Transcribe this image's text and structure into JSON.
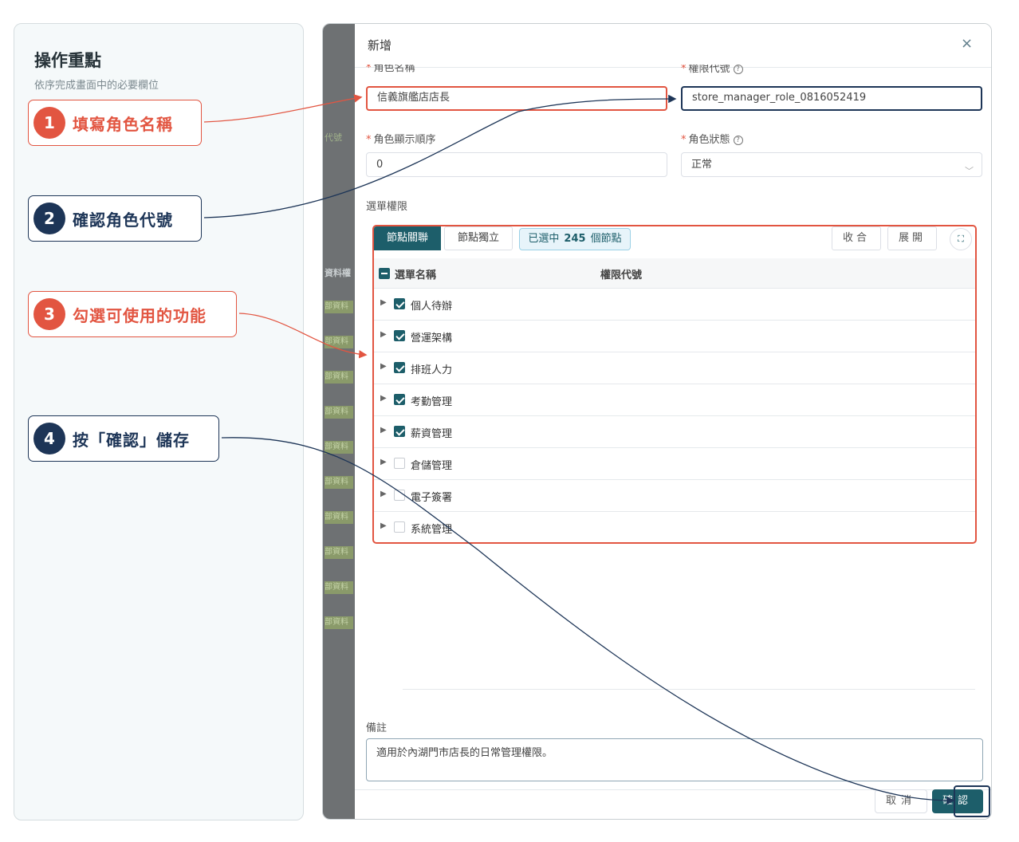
{
  "guide": {
    "title": "操作重點",
    "subtitle": "依序完成畫面中的必要欄位",
    "steps": [
      {
        "num": "1",
        "text": "填寫角色名稱"
      },
      {
        "num": "2",
        "text": "確認角色代號"
      },
      {
        "num": "3",
        "text": "勾選可使用的功能"
      },
      {
        "num": "4",
        "text": "按「確認」儲存"
      }
    ]
  },
  "background": {
    "code_label": "代號",
    "column_header": "資料權",
    "row_tag": "部資料"
  },
  "modal": {
    "title": "新增",
    "close_icon": "×",
    "fields": {
      "role_name": {
        "label": "角色名稱",
        "value": "信義旗艦店店長"
      },
      "permission_code": {
        "label": "權限代號",
        "value": "store_manager_role_0816052419"
      },
      "display_order": {
        "label": "角色顯示順序",
        "value": "0"
      },
      "role_status": {
        "label": "角色狀態",
        "value": "正常"
      }
    },
    "menu_permissions": {
      "label": "選單權限",
      "mode_linked": "節點關聯",
      "mode_independent": "節點獨立",
      "selected_prefix": "已選中",
      "selected_count": "245",
      "selected_suffix": "個節點",
      "collapse": "收合",
      "expand": "展開",
      "col_menu_name": "選單名稱",
      "col_permission_code": "權限代號",
      "rows": [
        {
          "label": "個人待辦",
          "checked": true
        },
        {
          "label": "營運架構",
          "checked": true
        },
        {
          "label": "排班人力",
          "checked": true
        },
        {
          "label": "考勤管理",
          "checked": true
        },
        {
          "label": "薪資管理",
          "checked": true
        },
        {
          "label": "倉儲管理",
          "checked": false
        },
        {
          "label": "電子簽署",
          "checked": false
        },
        {
          "label": "系統管理",
          "checked": false
        }
      ]
    },
    "notes": {
      "label": "備註",
      "value": "適用於內湖門市店長的日常管理權限。"
    },
    "cancel": "取消",
    "confirm": "確認"
  },
  "colors": {
    "accent_teal": "#1d5e6a",
    "highlight_red": "#e25541",
    "highlight_navy": "#1d3557"
  }
}
